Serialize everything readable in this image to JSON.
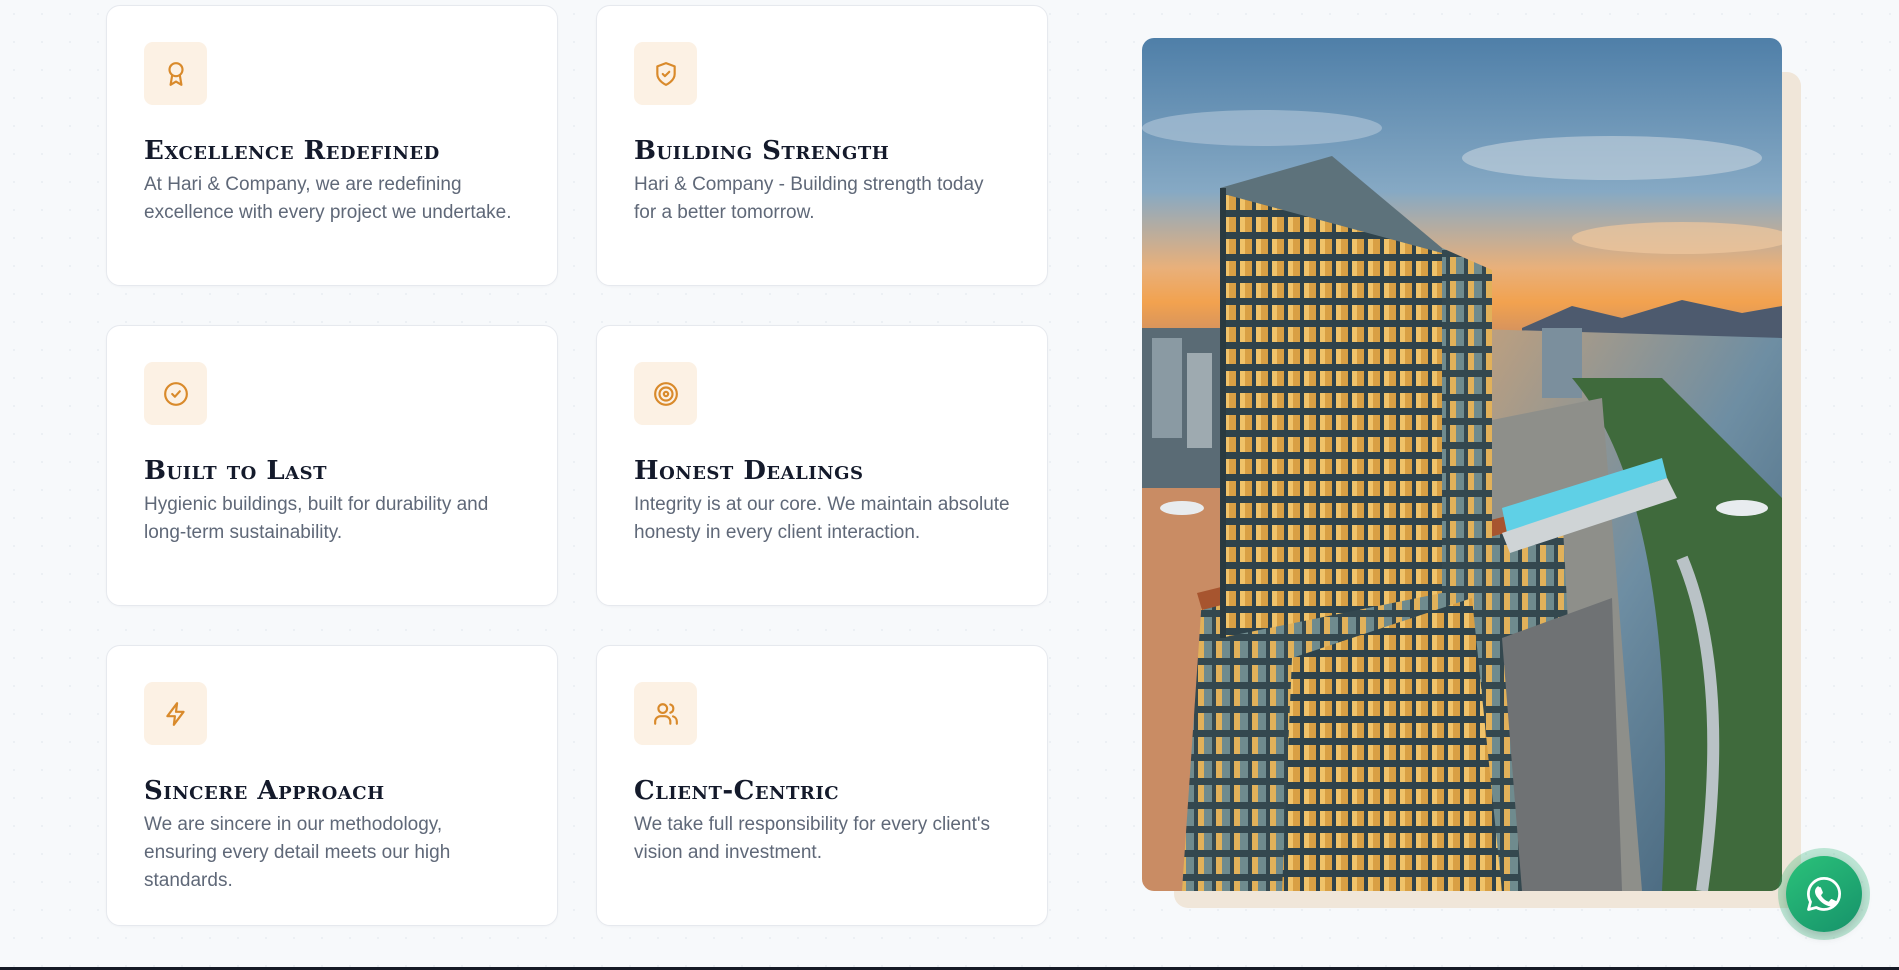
{
  "features": [
    {
      "icon": "award-ribbon-icon",
      "title": "Excellence Redefined",
      "description": "At Hari & Company, we are redefining excellence with every project we undertake."
    },
    {
      "icon": "shield-check-icon",
      "title": "Building Strength",
      "description": "Hari & Company - Building strength today for a better tomorrow."
    },
    {
      "icon": "circle-check-icon",
      "title": "Built to Last",
      "description": "Hygienic buildings, built for durability and long-term sustainability."
    },
    {
      "icon": "target-icon",
      "title": "Honest Dealings",
      "description": "Integrity is at our core. We maintain absolute honesty in every client interaction."
    },
    {
      "icon": "lightning-bolt-icon",
      "title": "Sincere Approach",
      "description": "We are sincere in our methodology, ensuring every detail meets our high standards."
    },
    {
      "icon": "users-icon",
      "title": "Client-Centric",
      "description": "We take full responsibility for every client's vision and investment."
    }
  ],
  "photo": {
    "icon": "building-photo"
  },
  "whatsapp": {
    "icon": "whatsapp-icon"
  },
  "colors": {
    "accent": "#d98a2b",
    "icon_bg": "#fcf1e4",
    "title": "#141a2b",
    "text": "#5f6878",
    "whatsapp": "#25b46e"
  }
}
